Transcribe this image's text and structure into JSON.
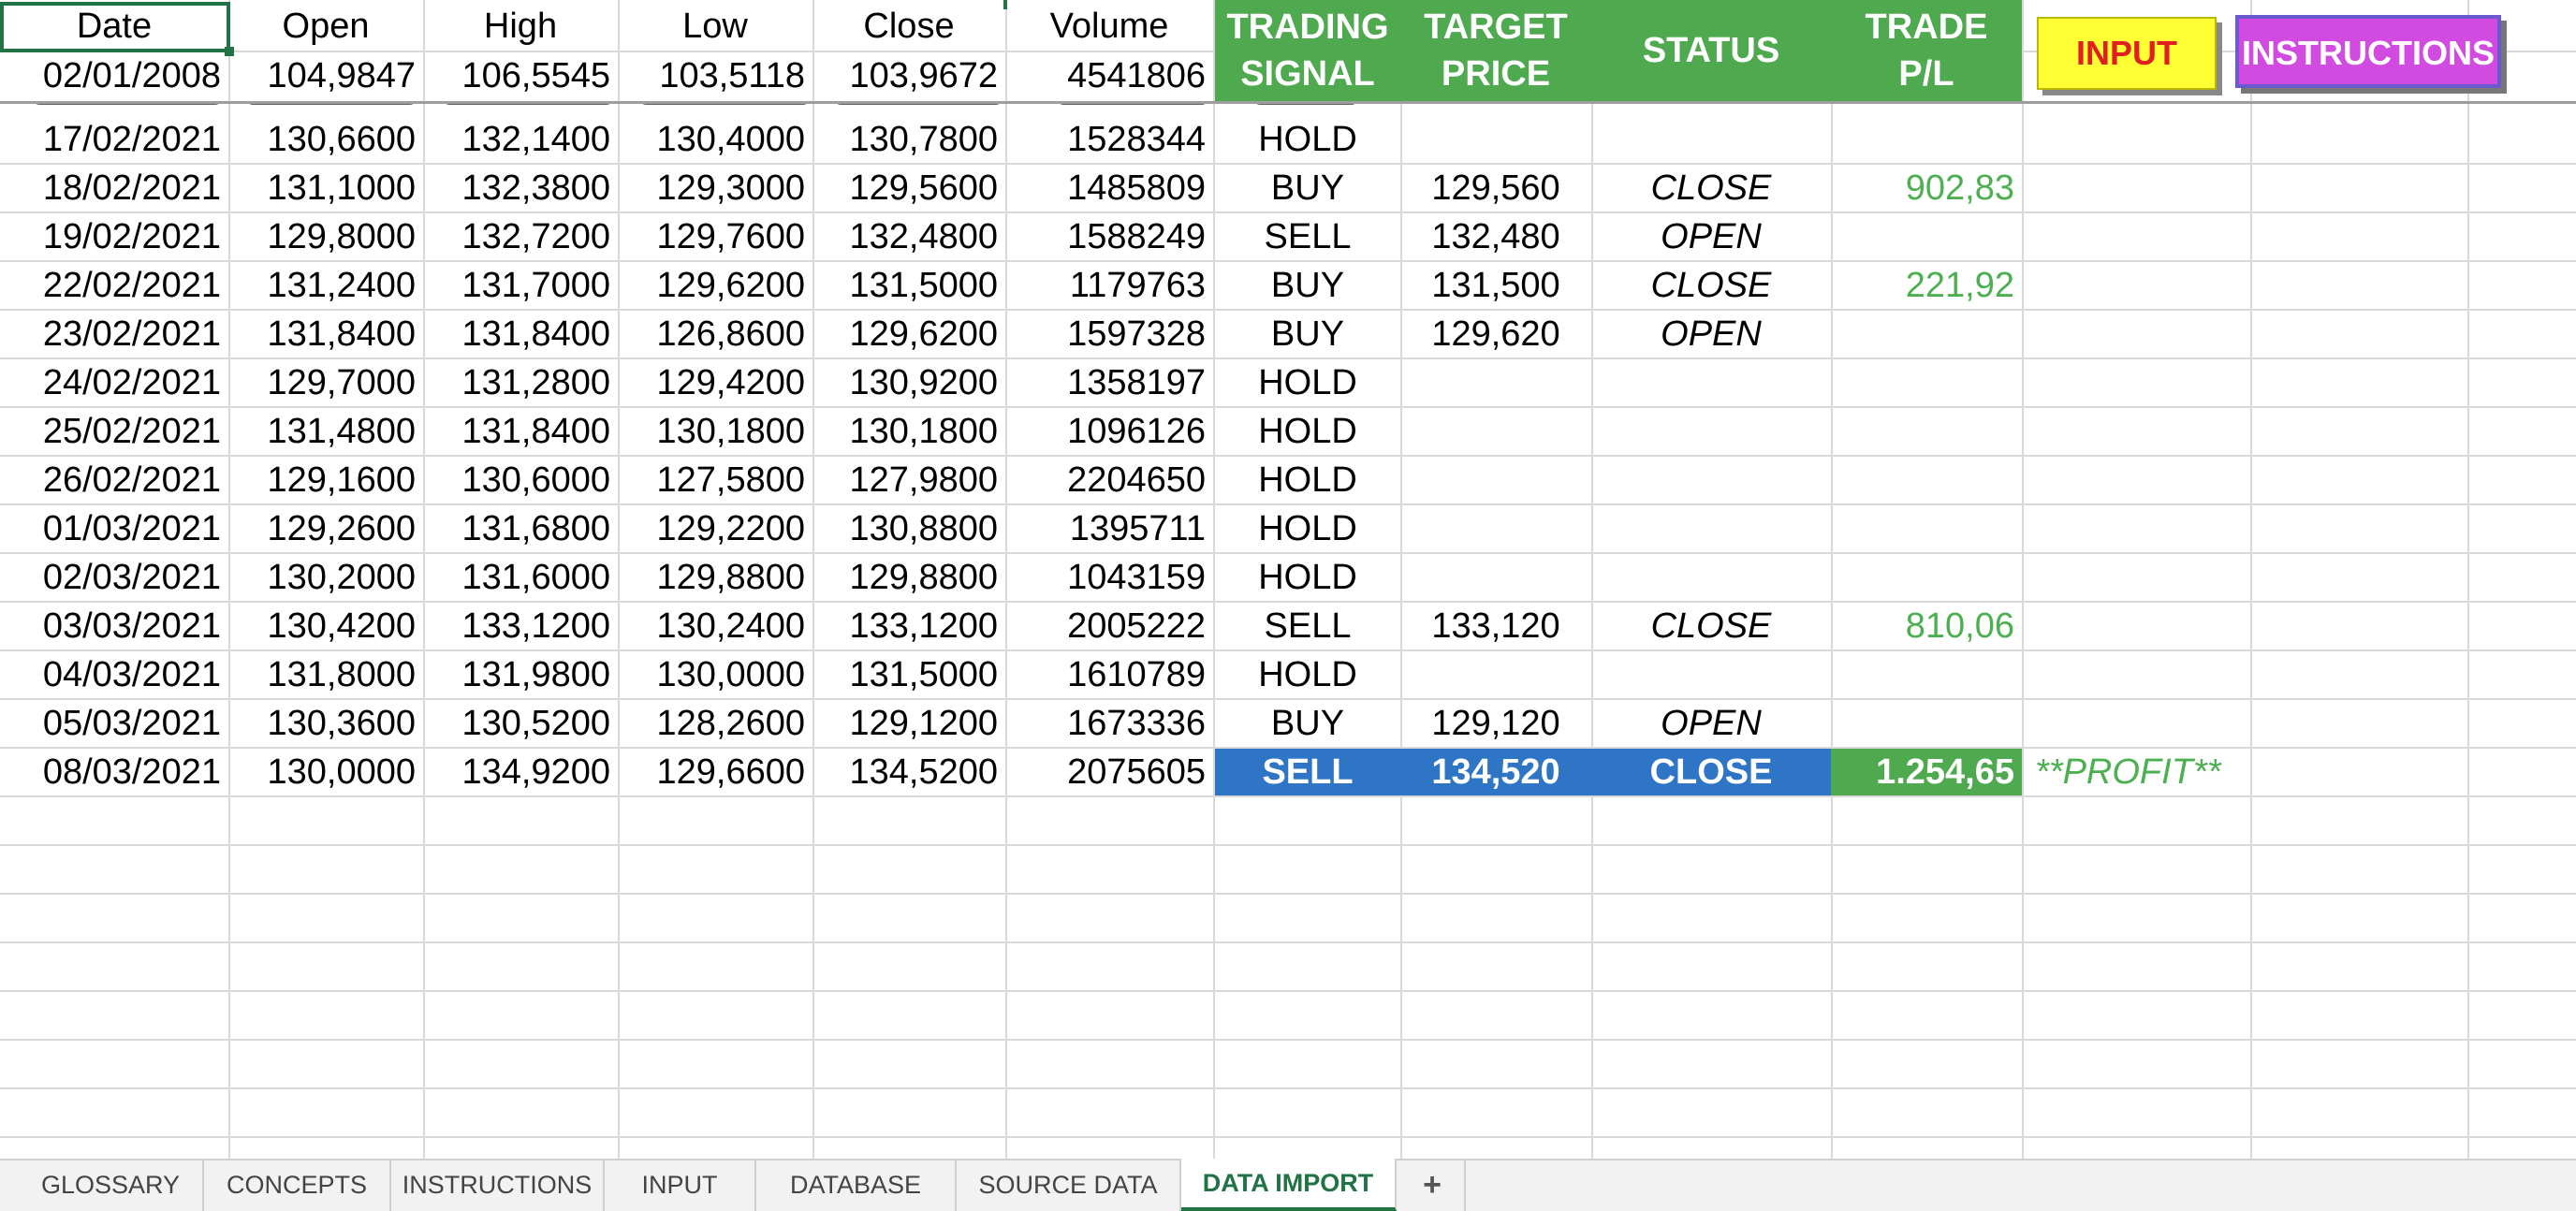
{
  "header": {
    "date": "Date",
    "open": "Open",
    "high": "High",
    "low": "Low",
    "close": "Close",
    "volume": "Volume",
    "signal_line1": "TRADING",
    "signal_line2": "SIGNAL",
    "target_line1": "TARGET",
    "target_line2": "PRICE",
    "status": "STATUS",
    "pl_line1": "TRADE",
    "pl_line2": "P/L"
  },
  "first_row": {
    "date": "02/01/2008",
    "open": "104,9847",
    "high": "106,5545",
    "low": "103,5118",
    "close": "103,9672",
    "volume": "4541806"
  },
  "buttons": {
    "input": "INPUT",
    "instructions": "INSTRUCTIONS"
  },
  "rows": [
    {
      "date": "17/02/2021",
      "open": "130,6600",
      "high": "132,1400",
      "low": "130,4000",
      "close": "130,7800",
      "volume": "1528344",
      "signal": "HOLD",
      "target": "",
      "status": "",
      "pl": "",
      "note": ""
    },
    {
      "date": "18/02/2021",
      "open": "131,1000",
      "high": "132,3800",
      "low": "129,3000",
      "close": "129,5600",
      "volume": "1485809",
      "signal": "BUY",
      "target": "129,560",
      "status": "CLOSE",
      "pl": "902,83",
      "note": ""
    },
    {
      "date": "19/02/2021",
      "open": "129,8000",
      "high": "132,7200",
      "low": "129,7600",
      "close": "132,4800",
      "volume": "1588249",
      "signal": "SELL",
      "target": "132,480",
      "status": "OPEN",
      "pl": "",
      "note": ""
    },
    {
      "date": "22/02/2021",
      "open": "131,2400",
      "high": "131,7000",
      "low": "129,6200",
      "close": "131,5000",
      "volume": "1179763",
      "signal": "BUY",
      "target": "131,500",
      "status": "CLOSE",
      "pl": "221,92",
      "note": ""
    },
    {
      "date": "23/02/2021",
      "open": "131,8400",
      "high": "131,8400",
      "low": "126,8600",
      "close": "129,6200",
      "volume": "1597328",
      "signal": "BUY",
      "target": "129,620",
      "status": "OPEN",
      "pl": "",
      "note": ""
    },
    {
      "date": "24/02/2021",
      "open": "129,7000",
      "high": "131,2800",
      "low": "129,4200",
      "close": "130,9200",
      "volume": "1358197",
      "signal": "HOLD",
      "target": "",
      "status": "",
      "pl": "",
      "note": ""
    },
    {
      "date": "25/02/2021",
      "open": "131,4800",
      "high": "131,8400",
      "low": "130,1800",
      "close": "130,1800",
      "volume": "1096126",
      "signal": "HOLD",
      "target": "",
      "status": "",
      "pl": "",
      "note": ""
    },
    {
      "date": "26/02/2021",
      "open": "129,1600",
      "high": "130,6000",
      "low": "127,5800",
      "close": "127,9800",
      "volume": "2204650",
      "signal": "HOLD",
      "target": "",
      "status": "",
      "pl": "",
      "note": ""
    },
    {
      "date": "01/03/2021",
      "open": "129,2600",
      "high": "131,6800",
      "low": "129,2200",
      "close": "130,8800",
      "volume": "1395711",
      "signal": "HOLD",
      "target": "",
      "status": "",
      "pl": "",
      "note": ""
    },
    {
      "date": "02/03/2021",
      "open": "130,2000",
      "high": "131,6000",
      "low": "129,8800",
      "close": "129,8800",
      "volume": "1043159",
      "signal": "HOLD",
      "target": "",
      "status": "",
      "pl": "",
      "note": ""
    },
    {
      "date": "03/03/2021",
      "open": "130,4200",
      "high": "133,1200",
      "low": "130,2400",
      "close": "133,1200",
      "volume": "2005222",
      "signal": "SELL",
      "target": "133,120",
      "status": "CLOSE",
      "pl": "810,06",
      "note": ""
    },
    {
      "date": "04/03/2021",
      "open": "131,8000",
      "high": "131,9800",
      "low": "130,0000",
      "close": "131,5000",
      "volume": "1610789",
      "signal": "HOLD",
      "target": "",
      "status": "",
      "pl": "",
      "note": ""
    },
    {
      "date": "05/03/2021",
      "open": "130,3600",
      "high": "130,5200",
      "low": "128,2600",
      "close": "129,1200",
      "volume": "1673336",
      "signal": "BUY",
      "target": "129,120",
      "status": "OPEN",
      "pl": "",
      "note": ""
    },
    {
      "date": "08/03/2021",
      "open": "130,0000",
      "high": "134,9200",
      "low": "129,6600",
      "close": "134,5200",
      "volume": "2075605",
      "signal": "SELL",
      "target": "134,520",
      "status": "CLOSE",
      "pl": "1.254,65",
      "note": "**PROFIT**"
    }
  ],
  "tabs": [
    {
      "label": "GLOSSARY",
      "active": false
    },
    {
      "label": "CONCEPTS",
      "active": false
    },
    {
      "label": "INSTRUCTIONS",
      "active": false
    },
    {
      "label": "INPUT",
      "active": false
    },
    {
      "label": "DATABASE",
      "active": false
    },
    {
      "label": "SOURCE DATA",
      "active": false
    },
    {
      "label": "DATA IMPORT",
      "active": true
    }
  ],
  "add_tab_label": "+",
  "colors": {
    "header_green": "#4ea94f",
    "highlight_blue": "#2e75c6",
    "profit_green": "#4caf50",
    "input_button": "#ffff33",
    "instructions_button": "#d14be0",
    "active_tab": "#217346"
  }
}
